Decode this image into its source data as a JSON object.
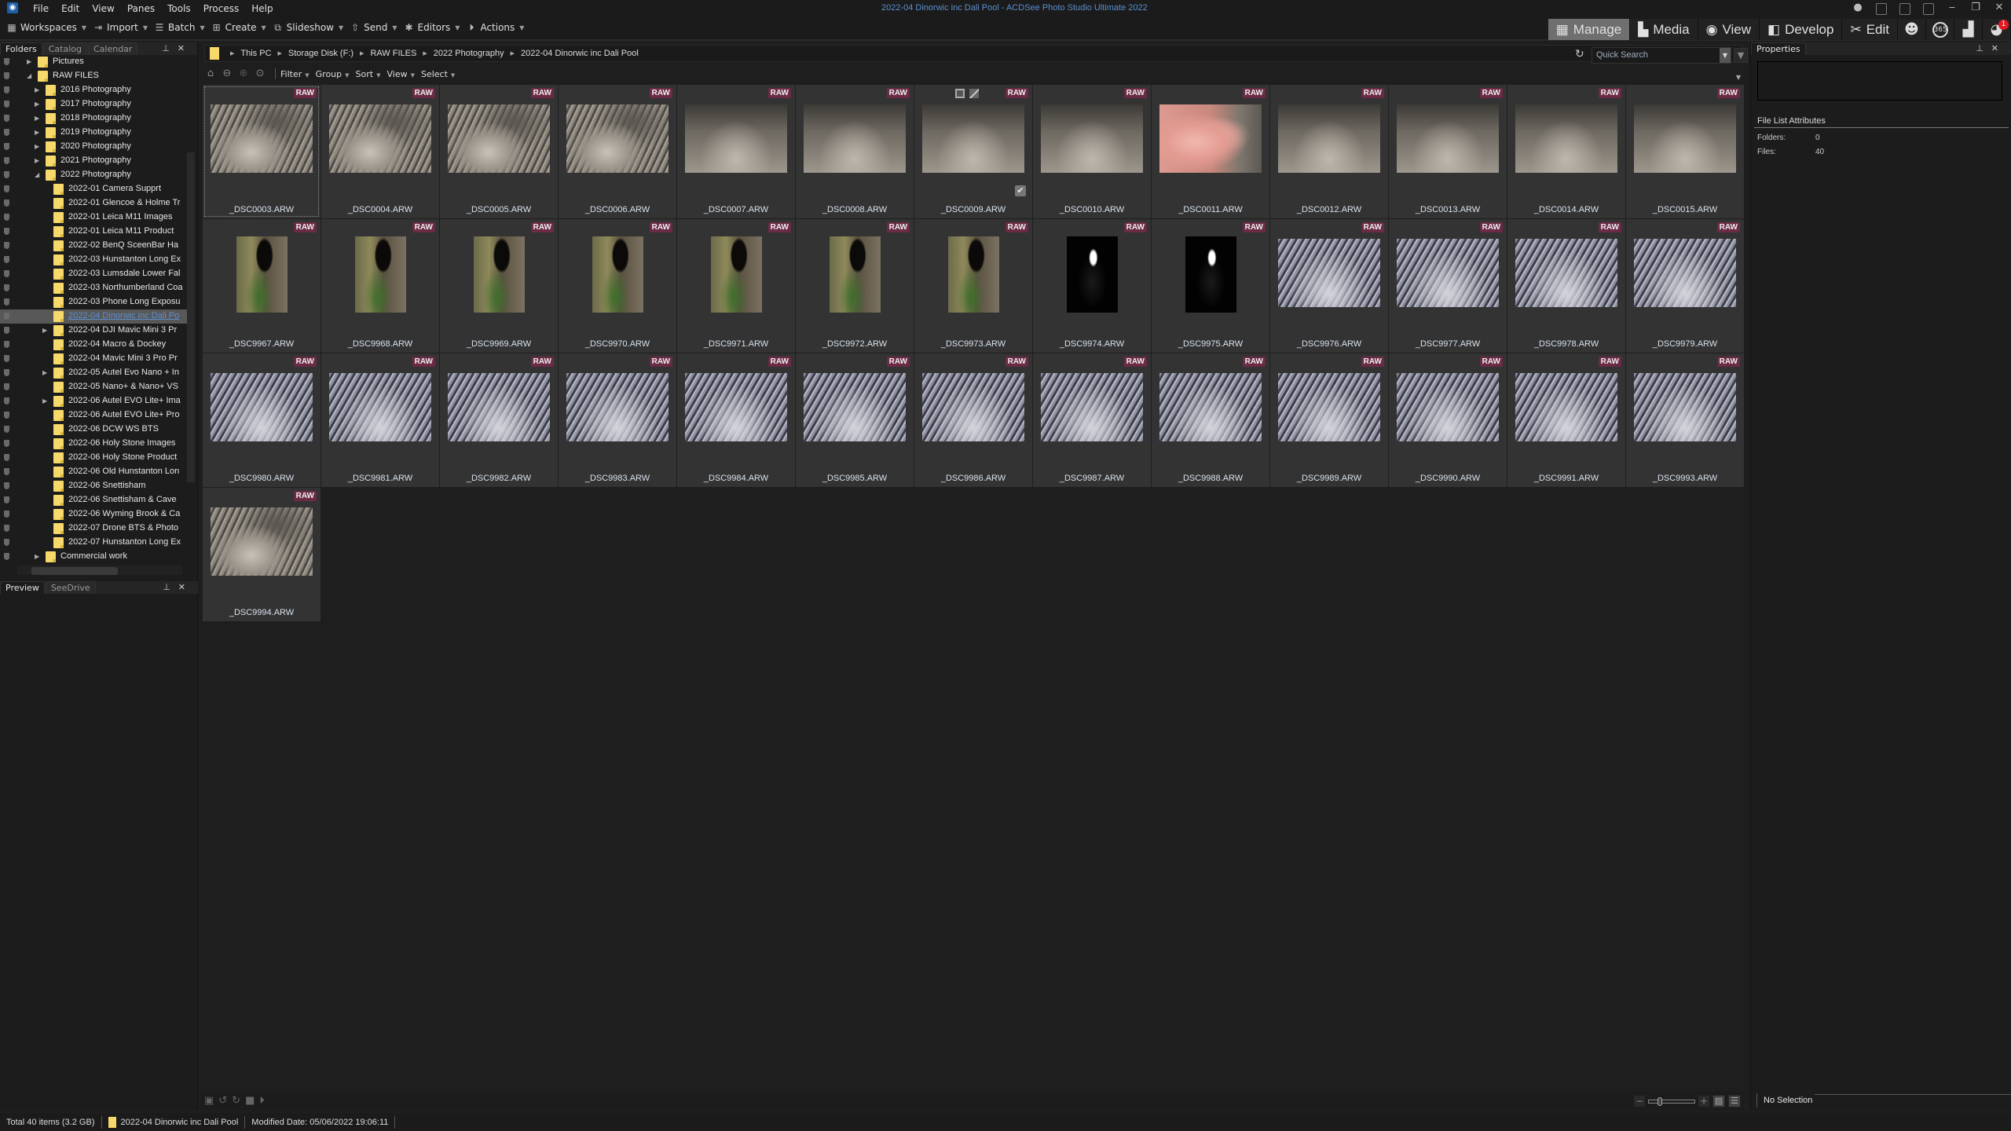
{
  "window": {
    "title": "2022-04 Dinorwic inc Dali Pool - ACDSee Photo Studio Ultimate 2022",
    "app_icon": "acdsee-logo-icon"
  },
  "menu": [
    "File",
    "Edit",
    "View",
    "Panes",
    "Tools",
    "Process",
    "Help"
  ],
  "toolbar": [
    {
      "label": "Workspaces",
      "icon": "workspaces-icon"
    },
    {
      "label": "Import",
      "icon": "import-icon"
    },
    {
      "label": "Batch",
      "icon": "batch-icon"
    },
    {
      "label": "Create",
      "icon": "create-icon"
    },
    {
      "label": "Slideshow",
      "icon": "slideshow-icon"
    },
    {
      "label": "Send",
      "icon": "send-icon"
    },
    {
      "label": "Editors",
      "icon": "editors-icon"
    },
    {
      "label": "Actions",
      "icon": "actions-icon"
    }
  ],
  "modes": [
    {
      "label": "Manage",
      "icon": "grid-icon",
      "active": true
    },
    {
      "label": "Media",
      "icon": "media-icon",
      "active": false
    },
    {
      "label": "View",
      "icon": "eye-icon",
      "active": false
    },
    {
      "label": "Develop",
      "icon": "develop-icon",
      "active": false
    },
    {
      "label": "Edit",
      "icon": "edit-tools-icon",
      "active": false
    }
  ],
  "mode_icons": [
    {
      "name": "people-icon"
    },
    {
      "name": "365-icon",
      "label": "365"
    },
    {
      "name": "dashboard-icon"
    },
    {
      "name": "notifications-icon",
      "badge": "1"
    }
  ],
  "left_panel": {
    "tabs": [
      "Folders",
      "Catalog",
      "Calendar"
    ],
    "active_tab": "Folders",
    "tree": [
      {
        "label": "Pictures",
        "level": 0,
        "arrow": "collapsed"
      },
      {
        "label": "RAW FILES",
        "level": 0,
        "arrow": "expanded"
      },
      {
        "label": "2016 Photography",
        "level": 1,
        "arrow": "collapsed"
      },
      {
        "label": "2017 Photography",
        "level": 1,
        "arrow": "collapsed"
      },
      {
        "label": "2018 Photography",
        "level": 1,
        "arrow": "collapsed"
      },
      {
        "label": "2019 Photography",
        "level": 1,
        "arrow": "collapsed"
      },
      {
        "label": "2020 Photography",
        "level": 1,
        "arrow": "collapsed"
      },
      {
        "label": "2021 Photography",
        "level": 1,
        "arrow": "collapsed"
      },
      {
        "label": "2022 Photography",
        "level": 1,
        "arrow": "expanded"
      },
      {
        "label": "2022-01 Camera Supprt",
        "level": 2,
        "arrow": "none"
      },
      {
        "label": "2022-01 Glencoe & Holme Tr",
        "level": 2,
        "arrow": "none"
      },
      {
        "label": "2022-01 Leica M11 Images",
        "level": 2,
        "arrow": "none"
      },
      {
        "label": "2022-01 Leica M11 Product",
        "level": 2,
        "arrow": "none"
      },
      {
        "label": "2022-02 BenQ SceenBar Ha",
        "level": 2,
        "arrow": "none"
      },
      {
        "label": "2022-03 Hunstanton Long Ex",
        "level": 2,
        "arrow": "none"
      },
      {
        "label": "2022-03 Lumsdale Lower Fal",
        "level": 2,
        "arrow": "none"
      },
      {
        "label": "2022-03 Northumberland Coa",
        "level": 2,
        "arrow": "none"
      },
      {
        "label": "2022-03 Phone Long Exposu",
        "level": 2,
        "arrow": "none"
      },
      {
        "label": "2022-04 Dinorwic inc Dali Po",
        "level": 2,
        "arrow": "none",
        "selected": true
      },
      {
        "label": "2022-04 DJI Mavic Mini 3 Pr",
        "level": 2,
        "arrow": "collapsed"
      },
      {
        "label": "2022-04 Macro & Dockey",
        "level": 2,
        "arrow": "none"
      },
      {
        "label": "2022-04 Mavic Mini 3 Pro Pr",
        "level": 2,
        "arrow": "none"
      },
      {
        "label": "2022-05 Autel Evo Nano + In",
        "level": 2,
        "arrow": "collapsed"
      },
      {
        "label": "2022-05 Nano+ & Nano+ VS",
        "level": 2,
        "arrow": "none"
      },
      {
        "label": "2022-06 Autel EVO Lite+ Ima",
        "level": 2,
        "arrow": "collapsed"
      },
      {
        "label": "2022-06 Autel EVO Lite+ Pro",
        "level": 2,
        "arrow": "none"
      },
      {
        "label": "2022-06 DCW WS BTS",
        "level": 2,
        "arrow": "none"
      },
      {
        "label": "2022-06 Holy Stone Images",
        "level": 2,
        "arrow": "none"
      },
      {
        "label": "2022-06 Holy Stone Product",
        "level": 2,
        "arrow": "none"
      },
      {
        "label": "2022-06 Old Hunstanton Lon",
        "level": 2,
        "arrow": "none"
      },
      {
        "label": "2022-06 Snettisham",
        "level": 2,
        "arrow": "none"
      },
      {
        "label": "2022-06 Snettisham & Cave",
        "level": 2,
        "arrow": "none"
      },
      {
        "label": "2022-06 Wyming Brook & Ca",
        "level": 2,
        "arrow": "none"
      },
      {
        "label": "2022-07 Drone BTS & Photo",
        "level": 2,
        "arrow": "none"
      },
      {
        "label": "2022-07 Hunstanton Long Ex",
        "level": 2,
        "arrow": "none"
      },
      {
        "label": "Commercial work",
        "level": 1,
        "arrow": "collapsed"
      }
    ],
    "preview_tabs": [
      "Preview",
      "SeeDrive"
    ]
  },
  "breadcrumb": [
    "This PC",
    "Storage Disk  (F:)",
    "RAW FILES",
    "2022 Photography",
    "2022-04 Dinorwic inc Dali Pool"
  ],
  "search": {
    "placeholder": "Quick Search"
  },
  "nav_menus": [
    "Filter",
    "Group",
    "Sort",
    "View",
    "Select"
  ],
  "badge_label": "RAW",
  "files": [
    {
      "name": "_DSC0003.ARW",
      "img": "rock",
      "focus": true
    },
    {
      "name": "_DSC0004.ARW",
      "img": "rock"
    },
    {
      "name": "_DSC0005.ARW",
      "img": "rock"
    },
    {
      "name": "_DSC0006.ARW",
      "img": "rock"
    },
    {
      "name": "_DSC0007.ARW",
      "img": "rock2"
    },
    {
      "name": "_DSC0008.ARW",
      "img": "rock2"
    },
    {
      "name": "_DSC0009.ARW",
      "img": "rock2",
      "hover": true
    },
    {
      "name": "_DSC0010.ARW",
      "img": "rock2"
    },
    {
      "name": "_DSC0011.ARW",
      "img": "hand"
    },
    {
      "name": "_DSC0012.ARW",
      "img": "rock2"
    },
    {
      "name": "_DSC0013.ARW",
      "img": "rock2"
    },
    {
      "name": "_DSC0014.ARW",
      "img": "rock2"
    },
    {
      "name": "_DSC0015.ARW",
      "img": "rock2"
    },
    {
      "name": "_DSC9967.ARW",
      "img": "falls",
      "portrait": true
    },
    {
      "name": "_DSC9968.ARW",
      "img": "falls",
      "portrait": true
    },
    {
      "name": "_DSC9969.ARW",
      "img": "falls",
      "portrait": true
    },
    {
      "name": "_DSC9970.ARW",
      "img": "falls",
      "portrait": true
    },
    {
      "name": "_DSC9971.ARW",
      "img": "falls",
      "portrait": true
    },
    {
      "name": "_DSC9972.ARW",
      "img": "falls",
      "portrait": true
    },
    {
      "name": "_DSC9973.ARW",
      "img": "falls",
      "portrait": true
    },
    {
      "name": "_DSC9974.ARW",
      "img": "dark",
      "portrait": true
    },
    {
      "name": "_DSC9975.ARW",
      "img": "dark",
      "portrait": true
    },
    {
      "name": "_DSC9976.ARW",
      "img": "blue"
    },
    {
      "name": "_DSC9977.ARW",
      "img": "blue"
    },
    {
      "name": "_DSC9978.ARW",
      "img": "blue"
    },
    {
      "name": "_DSC9979.ARW",
      "img": "blue"
    },
    {
      "name": "_DSC9980.ARW",
      "img": "blue"
    },
    {
      "name": "_DSC9981.ARW",
      "img": "blue"
    },
    {
      "name": "_DSC9982.ARW",
      "img": "blue"
    },
    {
      "name": "_DSC9983.ARW",
      "img": "blue"
    },
    {
      "name": "_DSC9984.ARW",
      "img": "blue"
    },
    {
      "name": "_DSC9985.ARW",
      "img": "blue"
    },
    {
      "name": "_DSC9986.ARW",
      "img": "blue"
    },
    {
      "name": "_DSC9987.ARW",
      "img": "blue"
    },
    {
      "name": "_DSC9988.ARW",
      "img": "blue"
    },
    {
      "name": "_DSC9989.ARW",
      "img": "blue"
    },
    {
      "name": "_DSC9990.ARW",
      "img": "blue"
    },
    {
      "name": "_DSC9991.ARW",
      "img": "blue"
    },
    {
      "name": "_DSC9993.ARW",
      "img": "blue"
    },
    {
      "name": "_DSC9994.ARW",
      "img": "rock"
    }
  ],
  "properties": {
    "title": "Properties",
    "section": "File List Attributes",
    "attrs": [
      {
        "key": "Folders:",
        "value": "0"
      },
      {
        "key": "Files:",
        "value": "40"
      }
    ],
    "selection": "No Selection"
  },
  "thumb_size_level": 0.2,
  "status": {
    "total": "Total 40 items  (3.2 GB)",
    "folder": "2022-04 Dinorwic inc Dali Pool",
    "modified": "Modified Date: 05/06/2022 19:06:11"
  },
  "colors": {
    "raw_badge": "#6b2a45",
    "accent_link": "#5b8fd0",
    "folder": "#f7d86a",
    "notification_badge": "#e01b24"
  }
}
